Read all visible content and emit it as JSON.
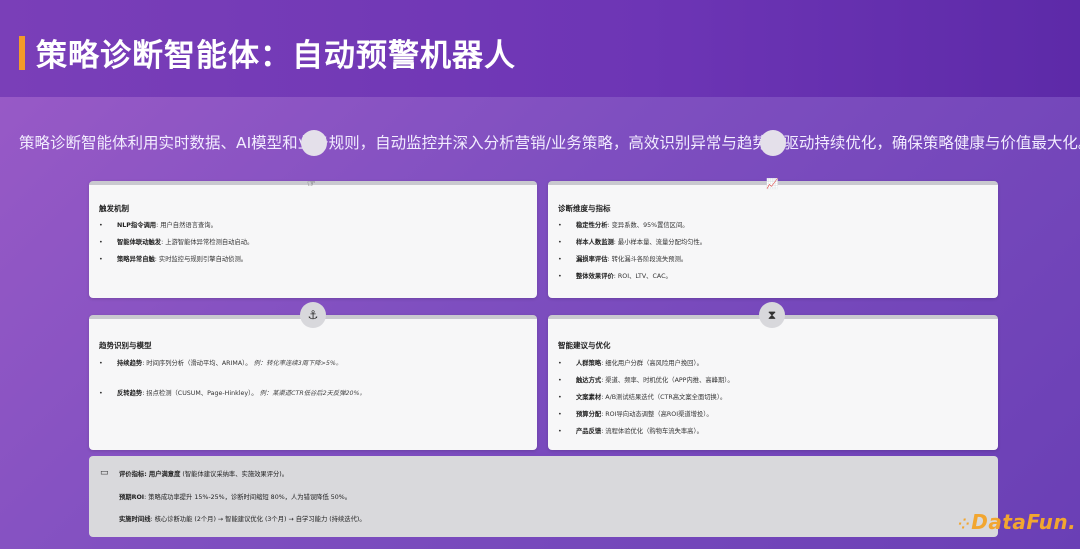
{
  "title": "策略诊断智能体：自动预警机器人",
  "intro": "策略诊断智能体利用实时数据、AI模型和业务规则，自动监控并深入分析营销/业务策略，高效识别异常与趋势，驱动持续优化，确保策略健康与价值最大化。",
  "cards": {
    "trigger": {
      "heading": "触发机制",
      "items": [
        {
          "label": "NLP指令调用",
          "text": ": 用户自然语言查询。"
        },
        {
          "label": "智能体联动触发",
          "text": ": 上游智能体异常检测自动启动。"
        },
        {
          "label": "策略异常自触",
          "text": ": 实时监控与规则引擎自动侦测。"
        }
      ]
    },
    "dimensions": {
      "heading": "诊断维度与指标",
      "items": [
        {
          "label": "稳定性分析",
          "text": ": 变异系数、95%置信区间。"
        },
        {
          "label": "样本人数监测",
          "text": ": 最小样本量、流量分配均匀性。"
        },
        {
          "label": "漏损率评估",
          "text": ": 转化漏斗各阶段流失预测。"
        },
        {
          "label": "整体效果评价",
          "text": ": ROI、LTV、CAC。"
        }
      ]
    },
    "trend": {
      "heading": "趋势识别与模型",
      "items": [
        {
          "label": "持续趋势",
          "text": ": 时间序列分析（滑动平均、ARIMA）。",
          "example": "例：转化率连续3周下降>5%。"
        },
        {
          "label": "反转趋势",
          "text": ": 拐点检测（CUSUM、Page-Hinkley）。",
          "example": "例：某渠道CTR低谷后2天反弹20%。"
        }
      ]
    },
    "suggest": {
      "heading": "智能建议与优化",
      "items": [
        {
          "label": "人群策略",
          "text": ": 细化用户分群（高风险用户挽回）。"
        },
        {
          "label": "触达方式",
          "text": ": 渠道、频率、时机优化（APP内推、高峰期）。"
        },
        {
          "label": "文案素材",
          "text": ": A/B测试结果迭代（CTR高文案全面切换）。"
        },
        {
          "label": "预算分配",
          "text": ": ROI导向动态调整（高ROI渠道增投）。"
        },
        {
          "label": "产品反馈",
          "text": ": 流程体验优化（购物车流失率高）。"
        }
      ]
    }
  },
  "summary": {
    "row1_label": "评价指标: 用户满意度",
    "row1_text": " (智能体建议采纳率、实施效果评分)。",
    "row2_label": "预期ROI",
    "row2_text": ": 策略成功率提升 15%-25%，诊断时间缩短 80%，人为错误降低 50%。",
    "row3_label": "实施时间线",
    "row3_text": ": 核心诊断功能 (2个月) → 智能建议优化 (3个月) → 自学习能力 (持续迭代)。"
  },
  "logo": "DataFun."
}
